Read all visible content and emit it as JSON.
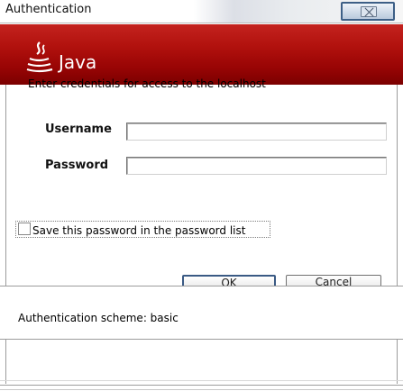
{
  "window": {
    "title": "Authentication",
    "close_icon": "close-icon"
  },
  "banner": {
    "logo_text": "Java",
    "logo_icon": "java-cup-icon",
    "colors": {
      "banner_top": "#c4231f",
      "banner_bottom": "#7b0000"
    }
  },
  "dialog": {
    "prompt": "Enter credentials for access to the localhost",
    "username_label": "Username",
    "username_value": "",
    "password_label": "Password",
    "password_value": "",
    "remember_label": "Save this password in the password list",
    "remember_checked": false,
    "ok_label": "OK",
    "cancel_label": "Cancel"
  },
  "footer": {
    "scheme_text": "Authentication scheme: basic"
  }
}
